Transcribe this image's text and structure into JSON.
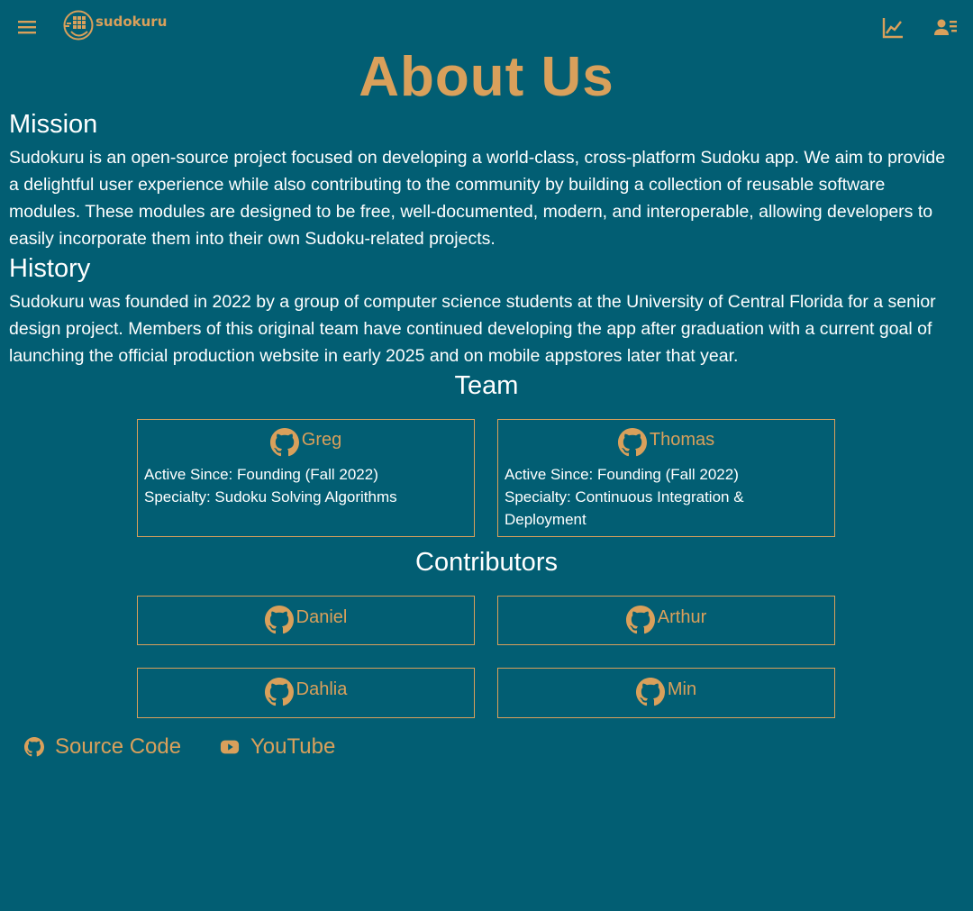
{
  "header": {
    "logo_text": "sudokuru"
  },
  "page_title": "About Us",
  "mission": {
    "heading": "Mission",
    "text": "Sudokuru is an open-source project focused on developing a world-class, cross-platform Sudoku app. We aim to provide a delightful user experience while also contributing to the community by building a collection of reusable software modules. These modules are designed to be free, well-documented, modern, and interoperable, allowing developers to easily incorporate them into their own Sudoku-related projects."
  },
  "history": {
    "heading": "History",
    "text": "Sudokuru was founded in 2022 by a group of computer science students at the University of Central Florida for a senior design project. Members of this original team have continued developing the app after graduation with a current goal of launching the official production website in early 2025 and on mobile appstores later that year."
  },
  "team": {
    "heading": "Team",
    "members": [
      {
        "name": "Greg",
        "active_since": "Active Since: Founding (Fall 2022)",
        "specialty": "Specialty: Sudoku Solving Algorithms"
      },
      {
        "name": "Thomas",
        "active_since": "Active Since: Founding (Fall 2022)",
        "specialty": "Specialty: Continuous Integration & Deployment"
      }
    ]
  },
  "contributors": {
    "heading": "Contributors",
    "members": [
      {
        "name": "Daniel"
      },
      {
        "name": "Arthur"
      },
      {
        "name": "Dahlia"
      },
      {
        "name": "Min"
      }
    ]
  },
  "footer": {
    "source_code_label": "Source Code",
    "youtube_label": "YouTube"
  },
  "colors": {
    "background": "#025e73",
    "accent": "#d9a05b",
    "text": "#ffffff"
  },
  "icons": {
    "menu": "hamburger-menu-icon",
    "stats": "line-chart-icon",
    "profile": "user-profile-icon",
    "github": "github-icon",
    "youtube": "youtube-icon"
  }
}
